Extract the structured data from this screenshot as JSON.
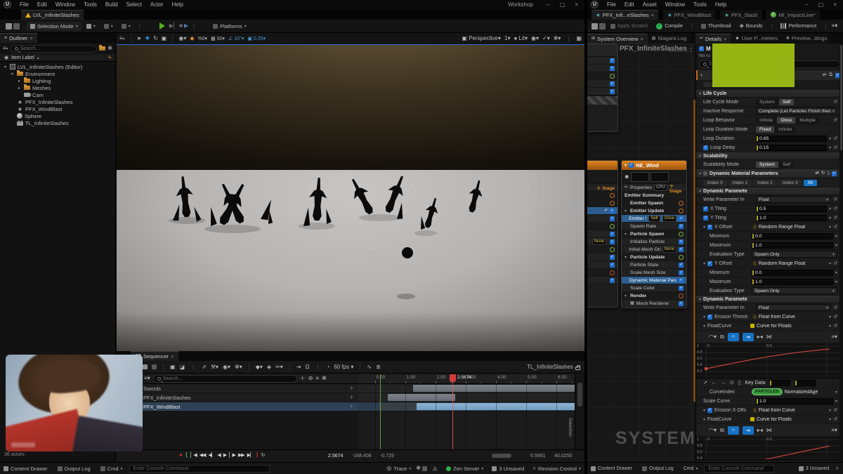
{
  "left_window": {
    "menu": [
      "File",
      "Edit",
      "Window",
      "Tools",
      "Build",
      "Select",
      "Actor",
      "Help"
    ],
    "workshop": "Workshop",
    "level_tab": "LVL_InfiniteSlashes",
    "toolbar": {
      "selection_mode": "Selection Mode",
      "platforms": "Platforms"
    },
    "outliner": {
      "tab": "Outliner",
      "search_placeholder": "Search...",
      "column_header": "Item Label",
      "footer": "36 actors",
      "items": [
        {
          "label": "LVL_InfiniteSlashes (Editor)",
          "depth": 0,
          "icon": "level",
          "arrow": "open"
        },
        {
          "label": "Environment",
          "depth": 1,
          "icon": "folder",
          "arrow": "open"
        },
        {
          "label": "Lighting",
          "depth": 2,
          "icon": "folder",
          "arrow": "closed"
        },
        {
          "label": "Meshes",
          "depth": 2,
          "icon": "folder",
          "arrow": "closed"
        },
        {
          "label": "Cam",
          "depth": 2,
          "icon": "cam",
          "arrow": "none"
        },
        {
          "label": "PFX_InfiniteSlashes",
          "depth": 1,
          "icon": "niagara",
          "arrow": "none"
        },
        {
          "label": "PFX_WindBlast",
          "depth": 1,
          "icon": "niagara",
          "arrow": "none"
        },
        {
          "label": "Sphere",
          "depth": 1,
          "icon": "sphere",
          "arrow": "none"
        },
        {
          "label": "TL_InfiniteSlashes",
          "depth": 1,
          "icon": "sequence",
          "arrow": "none"
        }
      ]
    },
    "viewport": {
      "perspective": "Perspective",
      "lit": "Lit",
      "cam_speed": "1",
      "percent": "0",
      "grid_snap": "50",
      "rot_snap": "10°",
      "scale_snap": "0.25"
    },
    "sequencer": {
      "tab": "Sequencer",
      "fps": "60 fps",
      "search_placeholder": "Search...",
      "sequence_name": "TL_InfiniteSlashes",
      "selection_label": "Selection",
      "tracks": [
        {
          "label": "Swords",
          "icon": "folder",
          "selected": false,
          "bar": {
            "start": 1.26,
            "end": 6.7,
            "kind": "gray"
          }
        },
        {
          "label": "PFX_InfiniteSlashes",
          "icon": "niagara",
          "selected": false,
          "bar": {
            "start": 0.42,
            "end": 2.66,
            "kind": "gray"
          }
        },
        {
          "label": "PFX_WindBlast",
          "icon": "niagara",
          "selected": true,
          "prebar": {
            "start": 0.12,
            "end": 1.38
          },
          "bar": {
            "start": 1.38,
            "end": 6.7,
            "kind": "blue"
          }
        }
      ],
      "ruler": [
        {
          "t": 0,
          "label": "0.00"
        },
        {
          "t": 1,
          "label": "1.00"
        },
        {
          "t": 2,
          "label": "2.00"
        },
        {
          "t": 3,
          "label": "3.00"
        },
        {
          "t": 4,
          "label": "4.00"
        },
        {
          "t": 5,
          "label": "5.00"
        },
        {
          "t": 6,
          "label": "6.00"
        }
      ],
      "playhead": {
        "t": 2.5674,
        "label": "2.5674"
      },
      "range_start_t": 0.18,
      "transport": {
        "time": "2.5674",
        "left_values": [
          "-168.408",
          "-0.729"
        ],
        "right_values": [
          "6.5681",
          "40.0255"
        ]
      }
    },
    "statusbar": {
      "content_drawer": "Content Drawer",
      "output_log": "Output Log",
      "cmd": "Cmd",
      "console_placeholder": "Enter Console Command",
      "trace": "Trace",
      "zen_server": "Zen Server",
      "unsaved": "3 Unsaved",
      "revision": "Revision Control"
    }
  },
  "right_window": {
    "menu": [
      "File",
      "Edit",
      "Asset",
      "Window",
      "Tools",
      "Help"
    ],
    "asset_tabs": [
      {
        "label": "PFX_Infi...eSlashes",
        "icon": "niagara",
        "active": true,
        "close": true
      },
      {
        "label": "PFX_WindBlast",
        "icon": "niagara",
        "active": false,
        "close": false
      },
      {
        "label": "PFX_Slash",
        "icon": "niagara",
        "active": false,
        "close": false
      },
      {
        "label": "MI_ImpactLine*",
        "icon": "material",
        "active": false,
        "close": false
      }
    ],
    "toolbar": {
      "apply_scratch": "Apply Scratch",
      "compile": "Compile",
      "thumbnail": "Thumbnail",
      "bounds": "Bounds",
      "performance": "Performance"
    },
    "panel_tabs": {
      "system_overview": "System Overview",
      "niagara_log": "Niagara Log",
      "details": "Details",
      "user_parameters": "User P...meters",
      "preview_settings": "Preview...ttings"
    },
    "graph": {
      "title": "PFX_InfiniteSlashes",
      "zoom": "Zoom 1:1",
      "watermark": "SYSTEM",
      "node": {
        "name": "NE_Wind",
        "properties_label": "Properties",
        "cpu_badge": "CPU",
        "stage_label": "Stage",
        "rows": [
          {
            "type": "summary",
            "label": "Emitter Summary"
          },
          {
            "type": "group",
            "label": "Emitter Spawn",
            "circle": "orange",
            "arrow": false
          },
          {
            "type": "group",
            "label": "Emitter Update",
            "circle": "orange",
            "arrow": true
          },
          {
            "type": "mod",
            "label": "Emitter State",
            "chips": [
              "Self",
              "Once"
            ],
            "selected": true
          },
          {
            "type": "mod",
            "label": "Spawn Rate"
          },
          {
            "type": "group",
            "label": "Particle Spawn",
            "circle": "green",
            "arrow": true
          },
          {
            "type": "mod",
            "label": "Initialize Particle"
          },
          {
            "type": "mod",
            "label": "Initial Mesh Orientation",
            "chips": [
              "None"
            ]
          },
          {
            "type": "group",
            "label": "Particle Update",
            "circle": "green",
            "arrow": true
          },
          {
            "type": "mod",
            "label": "Particle State"
          },
          {
            "type": "mod",
            "label": "Scale Mesh Size"
          },
          {
            "type": "mod",
            "label": "Dynamic Material Parameters",
            "selected": true
          },
          {
            "type": "mod",
            "label": "Scale Color"
          },
          {
            "type": "group",
            "label": "Render",
            "circle": "red",
            "arrow": true
          },
          {
            "type": "mod",
            "label": "Mesh Renderer",
            "icon": true
          }
        ]
      }
    },
    "details": {
      "partial_text": "No ru",
      "search_placeholder": "Search",
      "rows": [
        {
          "type": "section",
          "label": "Life Cycle"
        },
        {
          "type": "seg",
          "label": "Life Cycle Mode",
          "options": [
            "System",
            "Self"
          ],
          "selected": "Self",
          "reset": true
        },
        {
          "type": "dropdown",
          "label": "Inactive Response",
          "value": "Complete (Let Particles Finish then Kill"
        },
        {
          "type": "seg",
          "label": "Loop Behavior",
          "options": [
            "Infinite",
            "Once",
            "Multiple"
          ],
          "selected": "Once",
          "reset": true
        },
        {
          "type": "seg",
          "label": "Loop Duration Mode",
          "options": [
            "Fixed",
            "Infinite"
          ],
          "selected": "Fixed"
        },
        {
          "type": "input",
          "label": "Loop Duration",
          "value": "0.65",
          "caret": true,
          "reset": true
        },
        {
          "type": "input",
          "label": "Loop Delay",
          "value": "0.15",
          "check": true,
          "caret": true,
          "reset": true
        },
        {
          "type": "section",
          "label": "Scalability"
        },
        {
          "type": "seg",
          "label": "Scalability Mode",
          "options": [
            "System",
            "Self"
          ],
          "selected": "System"
        },
        {
          "type": "section2",
          "label": "Dynamic Material Parameters"
        },
        {
          "type": "tabs",
          "options": [
            "Index 0",
            "Index 1",
            "Index 2",
            "Index 3",
            "All"
          ],
          "selected": "All"
        },
        {
          "type": "section",
          "label": "Dynamic Paramete"
        },
        {
          "type": "dropdown2",
          "label": "Write Parameter In",
          "value": "Float",
          "reset": true
        },
        {
          "type": "input",
          "label": "X Tiling",
          "value": "0.5",
          "check": true,
          "caret": true,
          "reset": true
        },
        {
          "type": "input",
          "label": "Y Tiling",
          "value": "1.0",
          "check": true,
          "caret": true,
          "reset": true
        },
        {
          "type": "dyn",
          "label": "X Offset",
          "value": "Random Range Float",
          "check": true,
          "reset": true
        },
        {
          "type": "input",
          "label": "Minimum",
          "value": "0.0",
          "sub": true,
          "caret": true
        },
        {
          "type": "input",
          "label": "Maximum",
          "value": "1.0",
          "sub": true,
          "caret": true
        },
        {
          "type": "dropdown2",
          "label": "Evaluation Type",
          "value": "Spawn Only",
          "sub": true
        },
        {
          "type": "dyn",
          "label": "Y Offset",
          "value": "Random Range Float",
          "check": true,
          "reset": true
        },
        {
          "type": "input",
          "label": "Minimum",
          "value": "0.0",
          "sub": true,
          "caret": true
        },
        {
          "type": "input",
          "label": "Maximum",
          "value": "1.0",
          "sub": true,
          "caret": true
        },
        {
          "type": "dropdown2",
          "label": "Evaluation Type",
          "value": "Spawn Only",
          "sub": true
        },
        {
          "type": "section",
          "label": "Dynamic Paramete"
        },
        {
          "type": "dropdown2",
          "label": "Write Parameter In",
          "value": "Float",
          "reset": true
        },
        {
          "type": "dyn",
          "label": "Erosion Thresh",
          "value": "Float from Curve",
          "check": true,
          "reset": true
        },
        {
          "type": "dyn2",
          "label": "FloatCurve",
          "value": "Curve for Floats",
          "reset": true
        },
        {
          "type": "curvebar"
        },
        {
          "type": "curve",
          "curve": "c1",
          "ylabels": [
            "1",
            "0.8",
            "0.6",
            "0.4",
            "0.2"
          ],
          "xlabels": [
            "0",
            "0.5"
          ]
        },
        {
          "type": "keyrow",
          "label": "Key Data"
        },
        {
          "type": "pillrow",
          "label": "CurveIndex",
          "pill": "PARTICLES",
          "value": "NormalizedAge"
        },
        {
          "type": "input",
          "label": "Scale Curve",
          "value": "1.0",
          "caret": true
        },
        {
          "type": "dyn",
          "label": "Erosion X Offs",
          "value": "Float from Curve",
          "check": true,
          "reset": true
        },
        {
          "type": "dyn2",
          "label": "FloatCurve",
          "value": "Curve for Floats",
          "reset": true
        },
        {
          "type": "curvebar"
        },
        {
          "type": "curve",
          "curve": "c2",
          "ylabels": [
            "1",
            "0.8",
            "0.6",
            "0.4"
          ],
          "xlabels": [
            "0",
            "0.5"
          ]
        }
      ]
    },
    "statusbar": {
      "content_drawer": "Content Drawer",
      "output_log": "Output Log",
      "cmd": "Cmd",
      "console_placeholder": "Enter Console Command",
      "unsaved": "3 Unsaved"
    }
  },
  "colors": {
    "accent_blue": "#1673c4",
    "node_orange": "#c66b1e",
    "green_overlay": "#97b414",
    "bar_blue": "#7fa8ca",
    "curve_red": "#c8453a"
  }
}
